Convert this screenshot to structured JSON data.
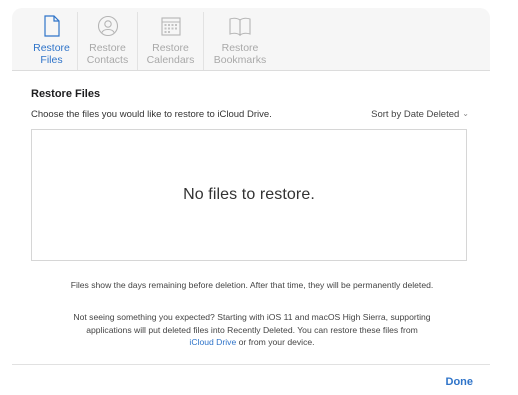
{
  "tabs": [
    {
      "label_line1": "Restore",
      "label_line2": "Files",
      "icon": "document-icon",
      "active": true
    },
    {
      "label_line1": "Restore",
      "label_line2": "Contacts",
      "icon": "contact-icon",
      "active": false
    },
    {
      "label_line1": "Restore",
      "label_line2": "Calendars",
      "icon": "calendar-icon",
      "active": false
    },
    {
      "label_line1": "Restore",
      "label_line2": "Bookmarks",
      "icon": "book-icon",
      "active": false
    }
  ],
  "main": {
    "title": "Restore Files",
    "subtitle": "Choose the files you would like to restore to iCloud Drive.",
    "sort_label": "Sort by Date Deleted",
    "empty_message": "No files to restore."
  },
  "notes": {
    "retention": "Files show the days remaining before deletion. After that time, they will be permanently deleted.",
    "help_text": "Not seeing something you expected? Starting with iOS 11 and macOS High Sierra, supporting applications will put deleted files into Recently Deleted. You can restore these files from",
    "help_link": "iCloud Drive",
    "help_suffix": " or from your device."
  },
  "footer": {
    "done_label": "Done"
  },
  "colors": {
    "accent": "#2f74c9",
    "inactive": "#a9a9a9"
  }
}
